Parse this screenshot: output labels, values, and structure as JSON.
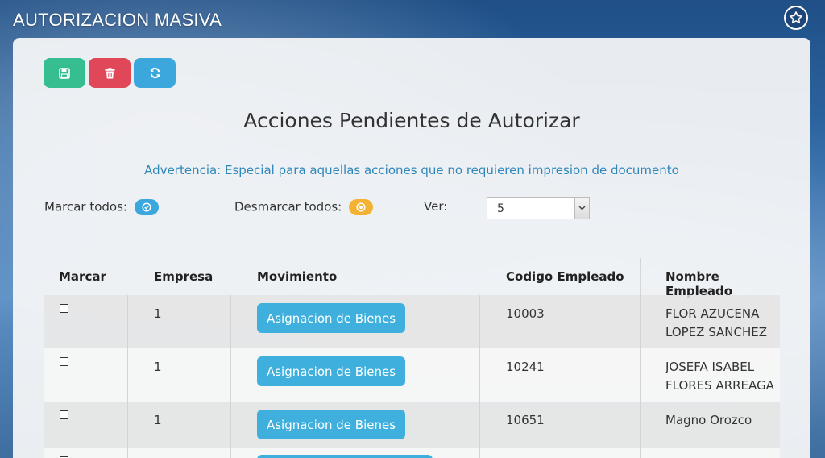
{
  "app": {
    "title": "AUTORIZACION MASIVA"
  },
  "toolbar": {
    "save_icon": "floppy-disk-icon",
    "delete_icon": "trash-icon",
    "refresh_icon": "refresh-icon"
  },
  "main": {
    "heading": "Acciones Pendientes de Autorizar",
    "warning": "Advertencia: Especial para aquellas acciones que no requieren impresion de documento",
    "mark_all_label": "Marcar todos:",
    "unmark_all_label": "Desmarcar todos:",
    "view_label": "Ver:",
    "view_value": "5"
  },
  "table": {
    "columns": [
      "Marcar",
      "Empresa",
      "Movimiento",
      "Codigo Empleado",
      "Nombre Empleado"
    ],
    "rows": [
      {
        "empresa": "1",
        "movimiento": "Asignacion de Bienes",
        "codigo": "10003",
        "nombre_l1": "FLOR AZUCENA",
        "nombre_l2": "LOPEZ SANCHEZ"
      },
      {
        "empresa": "1",
        "movimiento": "Asignacion de Bienes",
        "codigo": "10241",
        "nombre_l1": "JOSEFA ISABEL",
        "nombre_l2": "FLORES ARREAGA"
      },
      {
        "empresa": "1",
        "movimiento": "Asignacion de Bienes",
        "codigo": "10651",
        "nombre_l1": "Magno Orozco",
        "nombre_l2": ""
      }
    ]
  },
  "colors": {
    "save": "#36be90",
    "delete": "#e0485a",
    "refresh": "#3ba7dd",
    "warning_text": "#2f86b9",
    "mark_all": "#3ba7dd",
    "unmark_all": "#f4b234"
  }
}
